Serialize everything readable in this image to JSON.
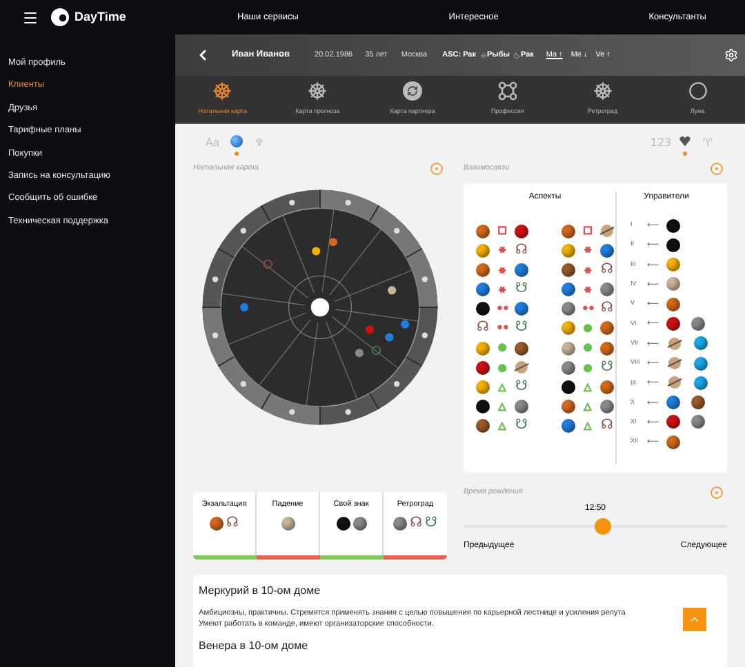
{
  "topbar": {
    "logo": "DayTime",
    "nav": [
      "Наши сервисы",
      "Интересное",
      "Консультанты"
    ]
  },
  "sidebar": {
    "items": [
      {
        "label": "Мой профиль",
        "selected": false
      },
      {
        "label": "Клиенты",
        "selected": true
      },
      {
        "label": "Друзья",
        "selected": false
      },
      {
        "label": "Тарифные планы",
        "selected": false
      },
      {
        "label": "Покупки",
        "selected": false
      },
      {
        "label": "Запись на консультацию",
        "selected": false
      },
      {
        "label": "Сообщить об ошибке",
        "selected": false
      },
      {
        "label": "Техническая поддержка",
        "selected": false
      }
    ]
  },
  "header": {
    "name": "Иван Иванов",
    "date": "20.02.1986",
    "age": "35 лет",
    "city": "Москва",
    "asc": "ASC: Рак",
    "sun": "Рыбы",
    "moon": "Рак",
    "planets": [
      {
        "label": "Ma",
        "arrow": "↑",
        "selected": true
      },
      {
        "label": "Me",
        "arrow": "↓",
        "selected": false
      },
      {
        "label": "Ve",
        "arrow": "↑",
        "selected": false
      }
    ]
  },
  "tabs": [
    {
      "label": "Натальная карта",
      "selected": true
    },
    {
      "label": "Карта прогноза",
      "selected": false
    },
    {
      "label": "Карта партнера",
      "selected": false
    },
    {
      "label": "Профессия",
      "selected": false
    },
    {
      "label": "Ретроград",
      "selected": false
    },
    {
      "label": "Луна",
      "selected": false
    }
  ],
  "toolbar": {
    "left": [
      {
        "kind": "text",
        "label": "Aa",
        "selected": false
      },
      {
        "kind": "globe",
        "selected": true
      },
      {
        "kind": "text",
        "label": "♆",
        "selected": false
      }
    ],
    "right": [
      {
        "kind": "text",
        "label": "123",
        "selected": false
      },
      {
        "kind": "icon",
        "selected": true
      },
      {
        "kind": "text",
        "label": "♈",
        "selected": false
      }
    ]
  },
  "natal_chart": {
    "title": "Натальная карта"
  },
  "relations": {
    "title": "Взаимосвязи",
    "aspects_title": "Аспекты",
    "rulers_title": "Управители",
    "aspects": [
      [
        {
          "left": {
            "kind": "planet",
            "color": "#d2691e"
          },
          "symbol": {
            "text": "□",
            "color": "#e05050"
          },
          "right": {
            "kind": "planet",
            "color": "#d01010"
          }
        },
        {
          "left": {
            "kind": "planet",
            "color": "#f5b000"
          },
          "symbol": {
            "text": "⚹",
            "color": "#e05050"
          },
          "right": {
            "kind": "node",
            "glyph": "☊",
            "color": "#8a4a3a"
          }
        },
        {
          "left": {
            "kind": "planet",
            "color": "#d2691e"
          },
          "symbol": {
            "text": "⚹",
            "color": "#e05050"
          },
          "right": {
            "kind": "planet",
            "color": "#1f7fe0"
          }
        },
        {
          "left": {
            "kind": "planet",
            "color": "#1f7fe0"
          },
          "symbol": {
            "text": "⚹",
            "color": "#e05050"
          },
          "right": {
            "kind": "node",
            "glyph": "☋",
            "color": "#3a7a4a"
          }
        },
        {
          "left": {
            "kind": "planet",
            "color": "#111111"
          },
          "symbol": {
            "text": "••",
            "color": "#e05050"
          },
          "right": {
            "kind": "planet",
            "color": "#1f7fe0"
          }
        },
        {
          "left": {
            "kind": "node",
            "glyph": "☊",
            "color": "#8a4a3a"
          },
          "symbol": {
            "text": "••",
            "color": "#e05050"
          },
          "right": {
            "kind": "node",
            "glyph": "☋",
            "color": "#3a7a4a"
          }
        },
        {
          "left": {
            "kind": "planet",
            "color": "#f5b000"
          },
          "symbol": {
            "text": "●",
            "color": "#66c24a"
          },
          "right": {
            "kind": "planet",
            "color": "#9a5a2a"
          }
        },
        {
          "left": {
            "kind": "planet",
            "color": "#d01010"
          },
          "symbol": {
            "text": "●",
            "color": "#66c24a"
          },
          "right": {
            "kind": "ringed"
          }
        },
        {
          "left": {
            "kind": "planet",
            "color": "#f5b000"
          },
          "symbol": {
            "text": "△",
            "color": "#66c24a"
          },
          "right": {
            "kind": "node",
            "glyph": "☋",
            "color": "#3a7a4a"
          }
        },
        {
          "left": {
            "kind": "planet",
            "color": "#111111"
          },
          "symbol": {
            "text": "△",
            "color": "#66c24a"
          },
          "right": {
            "kind": "planet",
            "color": "#8a8a8a"
          }
        },
        {
          "left": {
            "kind": "planet",
            "color": "#9a5a2a"
          },
          "symbol": {
            "text": "△",
            "color": "#66c24a"
          },
          "right": {
            "kind": "node",
            "glyph": "☋",
            "color": "#3a7a4a"
          }
        }
      ],
      [
        {
          "left": {
            "kind": "planet",
            "color": "#d2691e"
          },
          "symbol": {
            "text": "□",
            "color": "#e05050"
          },
          "right": {
            "kind": "ringed"
          }
        },
        {
          "left": {
            "kind": "planet",
            "color": "#f5b000"
          },
          "symbol": {
            "text": "⚹",
            "color": "#e05050"
          },
          "right": {
            "kind": "planet",
            "color": "#1f7fe0"
          }
        },
        {
          "left": {
            "kind": "planet",
            "color": "#9a5a2a"
          },
          "symbol": {
            "text": "⚹",
            "color": "#e05050"
          },
          "right": {
            "kind": "node",
            "glyph": "☊",
            "color": "#8a4a3a"
          }
        },
        {
          "left": {
            "kind": "planet",
            "color": "#1f7fe0"
          },
          "symbol": {
            "text": "⚹",
            "color": "#e05050"
          },
          "right": {
            "kind": "planet",
            "color": "#8a8a8a"
          }
        },
        {
          "left": {
            "kind": "planet",
            "color": "#8a8a8a"
          },
          "symbol": {
            "text": "••",
            "color": "#e05050"
          },
          "right": {
            "kind": "node",
            "glyph": "☊",
            "color": "#8a4a3a"
          }
        },
        {
          "left": {
            "kind": "planet",
            "color": "#f5b000"
          },
          "symbol": {
            "text": "●",
            "color": "#66c24a"
          },
          "right": {
            "kind": "planet",
            "color": "#d2691e"
          }
        },
        {
          "left": {
            "kind": "planet",
            "color": "#c9b49a"
          },
          "symbol": {
            "text": "●",
            "color": "#66c24a"
          },
          "right": {
            "kind": "planet",
            "color": "#d2691e"
          }
        },
        {
          "left": {
            "kind": "planet",
            "color": "#8a8a8a"
          },
          "symbol": {
            "text": "●",
            "color": "#66c24a"
          },
          "right": {
            "kind": "node",
            "glyph": "☋",
            "color": "#3a7a4a"
          }
        },
        {
          "left": {
            "kind": "planet",
            "color": "#111111"
          },
          "symbol": {
            "text": "△",
            "color": "#66c24a"
          },
          "right": {
            "kind": "planet",
            "color": "#d2691e"
          }
        },
        {
          "left": {
            "kind": "planet",
            "color": "#d2691e"
          },
          "symbol": {
            "text": "△",
            "color": "#66c24a"
          },
          "right": {
            "kind": "planet",
            "color": "#8a8a8a"
          }
        },
        {
          "left": {
            "kind": "planet",
            "color": "#1f7fe0"
          },
          "symbol": {
            "text": "△",
            "color": "#66c24a"
          },
          "right": {
            "kind": "node",
            "glyph": "☊",
            "color": "#8a4a3a"
          }
        }
      ]
    ],
    "rulers": [
      {
        "house": "I",
        "arrow": "⟵",
        "planets": [
          {
            "kind": "planet",
            "color": "#111111"
          }
        ]
      },
      {
        "house": "II",
        "arrow": "⟵",
        "planets": [
          {
            "kind": "planet",
            "color": "#111111"
          }
        ]
      },
      {
        "house": "III",
        "arrow": "⟵",
        "planets": [
          {
            "kind": "planet",
            "color": "#f5b000"
          }
        ]
      },
      {
        "house": "IV",
        "arrow": "⟵",
        "planets": [
          {
            "kind": "planet",
            "color": "#c9b49a"
          }
        ]
      },
      {
        "house": "V",
        "arrow": "⟵",
        "planets": [
          {
            "kind": "planet",
            "color": "#d2691e"
          }
        ]
      },
      {
        "house": "VI",
        "arrow": "⟵",
        "planets": [
          {
            "kind": "planet",
            "color": "#d01010"
          },
          {
            "kind": "planet",
            "color": "#8a8a8a"
          }
        ]
      },
      {
        "house": "VII",
        "arrow": "⟵",
        "planets": [
          {
            "kind": "ringed"
          },
          {
            "kind": "planet",
            "color": "#1aa8e8"
          }
        ]
      },
      {
        "house": "VIII",
        "arrow": "⟵",
        "planets": [
          {
            "kind": "ringed"
          },
          {
            "kind": "planet",
            "color": "#1aa8e8"
          }
        ]
      },
      {
        "house": "IX",
        "arrow": "⟵",
        "planets": [
          {
            "kind": "ringed"
          },
          {
            "kind": "planet",
            "color": "#1aa8e8"
          }
        ]
      },
      {
        "house": "X",
        "arrow": "⟵",
        "planets": [
          {
            "kind": "planet",
            "color": "#1f7fe0"
          },
          {
            "kind": "planet",
            "color": "#9a5a2a"
          }
        ]
      },
      {
        "house": "XI",
        "arrow": "⟵",
        "planets": [
          {
            "kind": "planet",
            "color": "#d01010"
          },
          {
            "kind": "planet",
            "color": "#8a8a8a"
          }
        ]
      },
      {
        "house": "XII",
        "arrow": "⟵",
        "planets": [
          {
            "kind": "planet",
            "color": "#d2691e"
          }
        ]
      }
    ]
  },
  "dignities": [
    {
      "title": "Экзальтация",
      "color": "#7dcc5a",
      "planets": [
        {
          "kind": "planet",
          "color": "#d2691e"
        },
        {
          "kind": "node",
          "glyph": "☊",
          "color": "#8a4a3a"
        }
      ]
    },
    {
      "title": "Падение",
      "color": "#f06050",
      "planets": [
        {
          "kind": "planet",
          "color": "#c9b49a"
        }
      ]
    },
    {
      "title": "Свой знак",
      "color": "#7dcc5a",
      "planets": [
        {
          "kind": "planet",
          "color": "#111111"
        },
        {
          "kind": "planet",
          "color": "#8a8a8a"
        }
      ]
    },
    {
      "title": "Ретроград",
      "color": "#f06050",
      "planets": [
        {
          "kind": "planet",
          "color": "#8a8a8a"
        },
        {
          "kind": "node",
          "glyph": "☊",
          "color": "#8a4a3a"
        },
        {
          "kind": "node",
          "glyph": "☋",
          "color": "#3a7a4a"
        }
      ]
    }
  ],
  "birth_time": {
    "title": "Время рождения",
    "value": "12:50",
    "level": 0.53,
    "prev": "Предыдущее",
    "next": "Следующее"
  },
  "article": [
    {
      "title": "Меркурий в 10-ом доме",
      "lines": [
        "Амбициозны, практичны. Стремятся применять знания с целью повышения по карьерной лестнице и усиления репута",
        "Умеют работать в команде, имеют организаторские способности."
      ]
    },
    {
      "title": "Венера в 10-ом доме"
    }
  ]
}
